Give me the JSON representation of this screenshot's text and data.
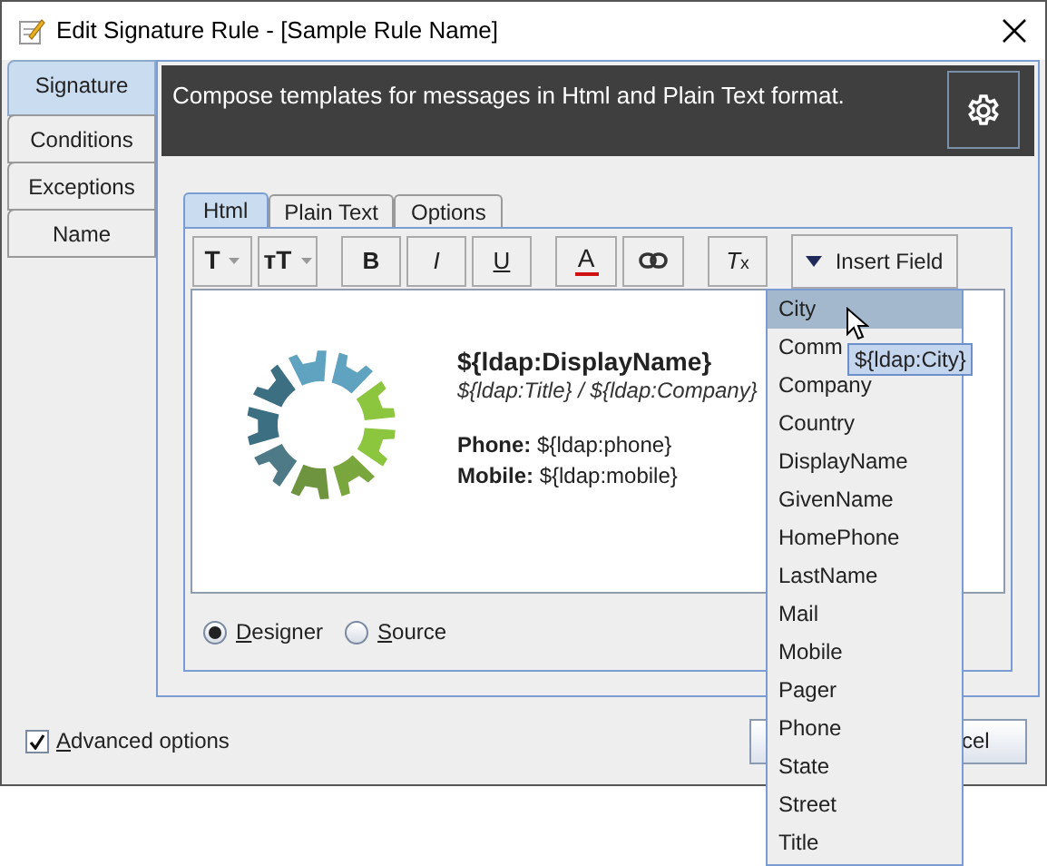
{
  "window": {
    "title": "Edit Signature Rule - [Sample Rule Name]"
  },
  "side_tabs": [
    {
      "label": "Signature",
      "selected": true
    },
    {
      "label": "Conditions",
      "selected": false
    },
    {
      "label": "Exceptions",
      "selected": false
    },
    {
      "label": "Name",
      "selected": false
    }
  ],
  "header": {
    "description": "Compose templates for messages in Html and Plain Text format."
  },
  "tabs": [
    {
      "label": "Html",
      "selected": true
    },
    {
      "label": "Plain Text",
      "selected": false
    },
    {
      "label": "Options",
      "selected": false
    }
  ],
  "toolbar": [
    {
      "kind": "font",
      "label": "T"
    },
    {
      "kind": "size",
      "label": "ᴛT"
    },
    {
      "kind": "gap"
    },
    {
      "kind": "bold",
      "label": "B"
    },
    {
      "kind": "italic",
      "label": "I"
    },
    {
      "kind": "underline",
      "label": "U"
    },
    {
      "kind": "gap"
    },
    {
      "kind": "color",
      "label": "A"
    },
    {
      "kind": "link"
    },
    {
      "kind": "gap"
    },
    {
      "kind": "clear",
      "label": "*T*$_{x}$"
    },
    {
      "kind": "gap"
    },
    {
      "kind": "insert",
      "label": "Insert Field"
    }
  ],
  "editor": {
    "name_line": "${ldap:DisplayName}",
    "title_line": "${ldap:Title} / ${ldap:Company}",
    "lines": [
      "**Phone:** ${ldap:phone}",
      "**Mobile:** ${ldap:mobile}"
    ]
  },
  "view_modes": [
    {
      "label": "Designer",
      "selected": true
    },
    {
      "label": "Source",
      "selected": false
    }
  ],
  "advanced_options": {
    "label": "Advanced options",
    "checked": true
  },
  "buttons": [
    {
      "kind": "ok"
    },
    {
      "kind": "cancel",
      "label": "cel"
    }
  ],
  "field_menu": {
    "items": [
      {
        "label": "City",
        "selected": true
      },
      {
        "label": "Comm",
        "selected": false
      },
      {
        "label": "Company",
        "selected": false
      },
      {
        "label": "Country",
        "selected": false
      },
      {
        "label": "DisplayName",
        "selected": false
      },
      {
        "label": "GivenName",
        "selected": false
      },
      {
        "label": "HomePhone",
        "selected": false
      },
      {
        "label": "LastName",
        "selected": false
      },
      {
        "label": "Mail",
        "selected": false
      },
      {
        "label": "Mobile",
        "selected": false
      },
      {
        "label": "Pager",
        "selected": false
      },
      {
        "label": "Phone",
        "selected": false
      },
      {
        "label": "State",
        "selected": false
      },
      {
        "label": "Street",
        "selected": false
      },
      {
        "label": "Title",
        "selected": false
      }
    ],
    "tooltip": "${ldap:City}"
  }
}
